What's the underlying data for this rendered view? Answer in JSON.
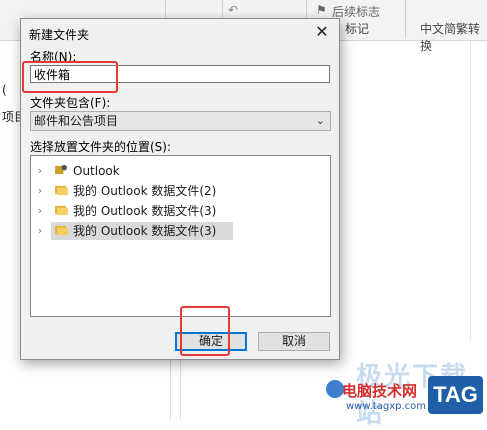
{
  "background": {
    "ribbon_tags": [
      "后续标志"
    ],
    "ribbon_groups": [
      "标记",
      "中文简繁转换"
    ],
    "left_fragments": [
      "(",
      "项目"
    ],
    "watermark": {
      "big": "极光下载站",
      "text": "电脑技术网",
      "url": "www.tagxp.com",
      "logo": "TAG"
    }
  },
  "dialog": {
    "title": "新建文件夹",
    "name_label": "名称(N):",
    "name_value": "收件箱",
    "contains_label": "文件夹包含(F):",
    "contains_value": "邮件和公告项目",
    "location_label": "选择放置文件夹的位置(S):",
    "tree": [
      {
        "label": "Outlook",
        "selected": false
      },
      {
        "label": "我的 Outlook 数据文件(2)",
        "selected": false
      },
      {
        "label": "我的 Outlook 数据文件(3)",
        "selected": false
      },
      {
        "label": "我的 Outlook 数据文件(3)",
        "selected": true
      }
    ],
    "ok_label": "确定",
    "cancel_label": "取消"
  },
  "colors": {
    "highlight": "#e53935",
    "accent": "#0078d7"
  }
}
